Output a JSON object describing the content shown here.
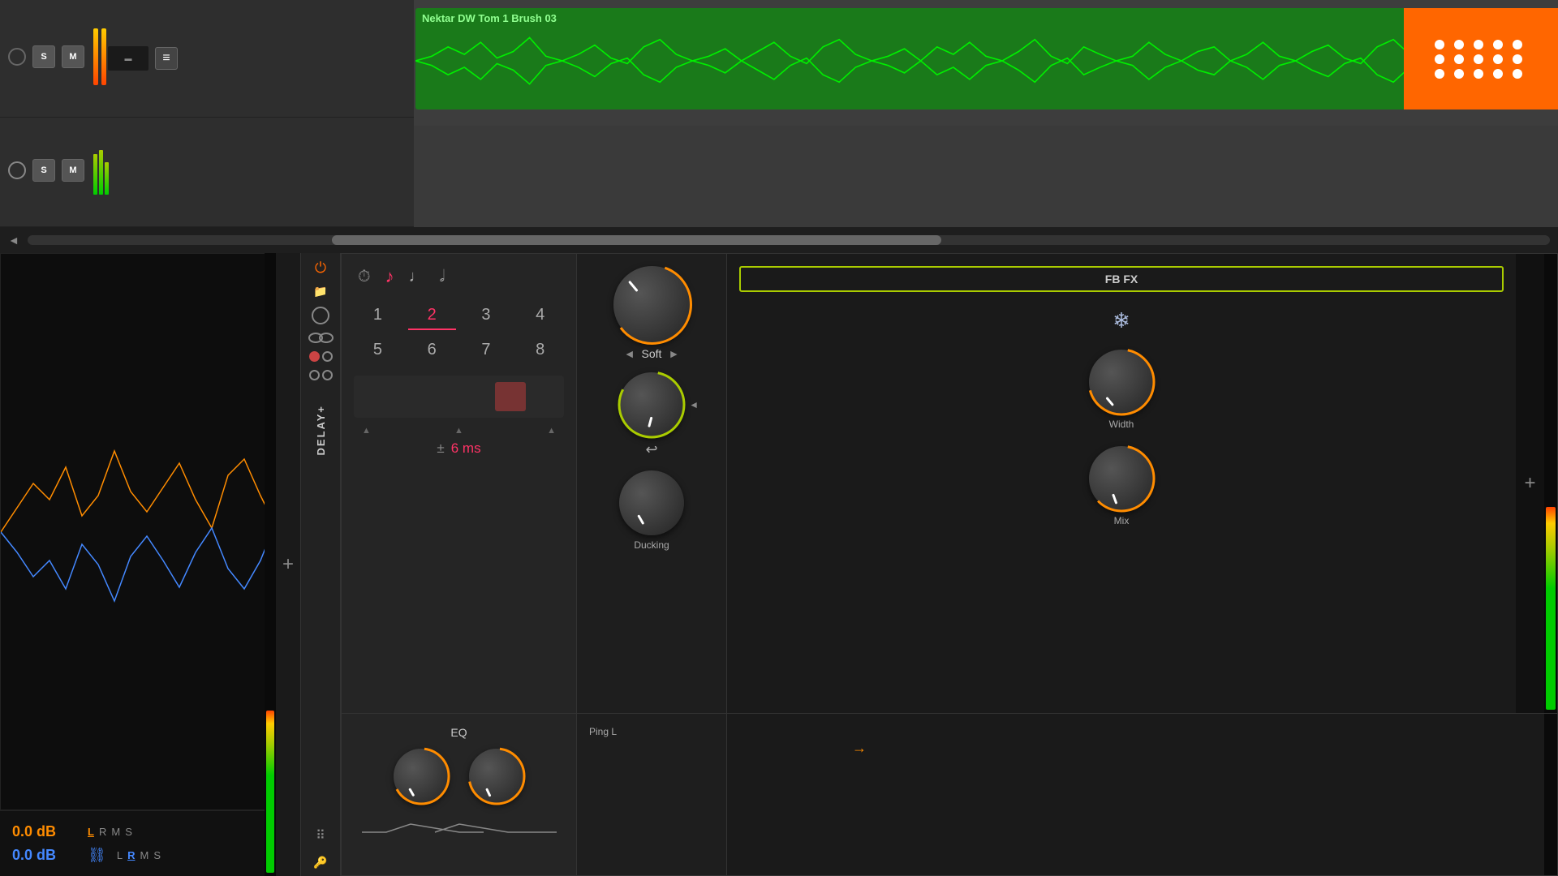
{
  "daw": {
    "track1": {
      "label": "Nektar DW Tom 1 Brush 03",
      "solo_label": "S",
      "mute_label": "M",
      "level_orange": "0.0 dB",
      "level_blue": "0.0 dB"
    },
    "track2": {
      "solo_label": "S",
      "mute_label": "M"
    }
  },
  "plugin": {
    "name": "DELAY+",
    "power_on": true,
    "note_icons": [
      "⏱",
      "♪",
      "♩",
      "𝅗𝅥"
    ],
    "numbers_row1": [
      "1",
      "2",
      "3",
      "4"
    ],
    "numbers_row2": [
      "5",
      "6",
      "7",
      "8"
    ],
    "active_number": "2",
    "delay_ms": "6 ms",
    "eq_label": "EQ",
    "ping_label": "Ping L",
    "soft_label": "Soft",
    "fbfx_label": "FB FX",
    "width_label": "Width",
    "ducking_label": "Ducking",
    "mix_label": "Mix",
    "channel_L": "L",
    "channel_R": "R",
    "channel_M": "M",
    "channel_S": "S",
    "level_orange": "0.0 dB",
    "level_blue": "0.0 dB",
    "plus_minus": "±"
  },
  "colors": {
    "accent_orange": "#ff6600",
    "accent_green": "#aacc00",
    "accent_red": "#ff3366",
    "accent_blue": "#4488ff",
    "bg_dark": "#1a1a1a",
    "bg_medium": "#2a2a2a",
    "knob_ring_green": "#aacc00",
    "knob_ring_orange": "#ff8c00"
  }
}
